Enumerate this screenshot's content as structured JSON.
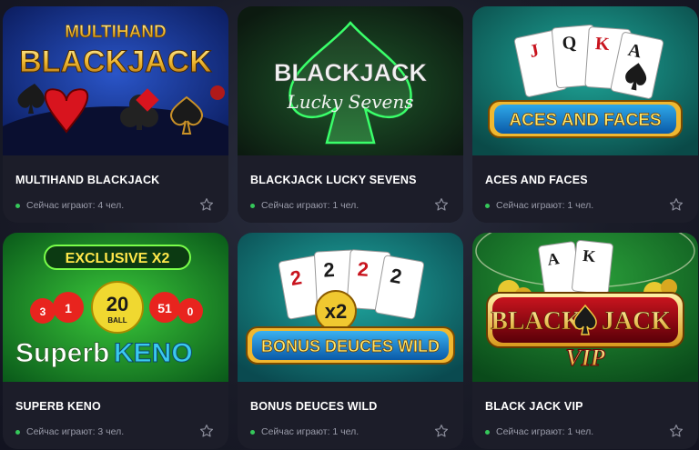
{
  "games": [
    {
      "title": "MULTIHAND BLACKJACK",
      "status": "Сейчас играют: 4 чел.",
      "art": {
        "line1": "MULTIHAND",
        "line2": "BLACKJACK"
      }
    },
    {
      "title": "BLACKJACK LUCKY SEVENS",
      "status": "Сейчас играют: 1 чел.",
      "art": {
        "line1": "BLACKJACK",
        "line2": "Lucky Sevens"
      }
    },
    {
      "title": "ACES AND FACES",
      "status": "Сейчас играют: 1 чел.",
      "art": {
        "line1": "ACES AND FACES",
        "card1": "J",
        "card2": "Q",
        "card3": "K",
        "card4": "A"
      }
    },
    {
      "title": "SUPERB KENO",
      "status": "Сейчас играют: 3 чел.",
      "art": {
        "line1": "EXCLUSIVE X2",
        "ball": "20",
        "ball_sub": "BALL",
        "ball_left1": "3",
        "ball_left2": "1",
        "ball_right1": "51",
        "ball_right2": "0",
        "logo1": "Superb",
        "logo2": "KENO"
      }
    },
    {
      "title": "BONUS DEUCES WILD",
      "status": "Сейчас играют: 1 чел.",
      "art": {
        "line1": "BONUS DEUCES WILD",
        "badge": "x2",
        "card1": "2",
        "card2": "2",
        "card3": "2",
        "card4": "2"
      }
    },
    {
      "title": "BLACK JACK VIP",
      "status": "Сейчас играют: 1 чел.",
      "art": {
        "line1": "BLACK",
        "line2": "JACK",
        "line3": "VIP",
        "card1": "A",
        "card2": "K"
      }
    }
  ],
  "icons": {
    "favorite": "star-outline-icon",
    "online": "online-dot-icon"
  },
  "colors": {
    "card_bg": "#1c1d29",
    "online": "#35c75a",
    "muted_text": "#9a9caa"
  }
}
